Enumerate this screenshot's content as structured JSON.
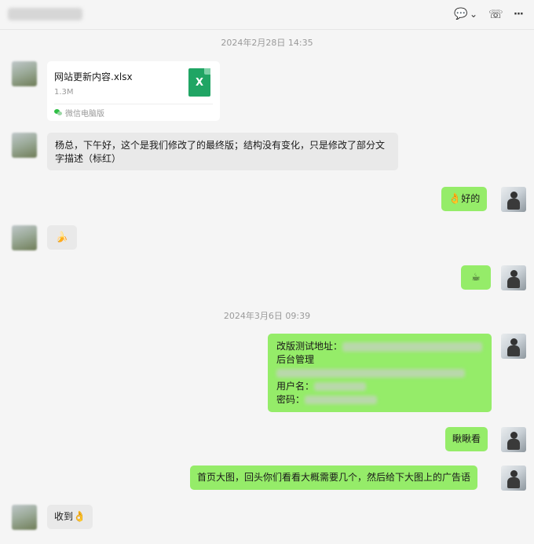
{
  "header": {
    "contact_name": "杨总",
    "icons": [
      "chat-icon",
      "chevron-down-icon",
      "call-icon",
      "more-icon"
    ],
    "chat_glyph": "💬",
    "chevron_glyph": "⌄",
    "call_glyph": "☏",
    "more_glyph": "···"
  },
  "timestamps": [
    "2024年2月28日 14:35",
    "2024年3月6日 09:39"
  ],
  "messages": [
    {
      "file": {
        "name": "网站更新内容.xlsx",
        "size": "1.3M",
        "source": "微信电脑版",
        "icon_letter": "X"
      }
    },
    {
      "text": "杨总，下午好，这个是我们修改了的最终版；结构没有变化，只是修改了部分文字描述（标红）"
    },
    {
      "emoji": "👌",
      "text": "好的"
    },
    {
      "emoji": "🍌"
    },
    {
      "emoji": "☕"
    },
    {
      "label1": "改版测试地址：",
      "line2": "后台管理",
      "label_user": "用户名：",
      "label_pass": "密码："
    },
    {
      "text": "瞅瞅看"
    },
    {
      "text": "首页大图，回头你们看看大概需要几个，然后给下大图上的广告语"
    },
    {
      "text": "收到",
      "emoji": "👌"
    }
  ],
  "colors": {
    "incoming_bubble": "#e9e9e9",
    "outgoing_bubble": "#95ec69",
    "excel_green": "#20a564",
    "background": "#f5f5f5"
  }
}
